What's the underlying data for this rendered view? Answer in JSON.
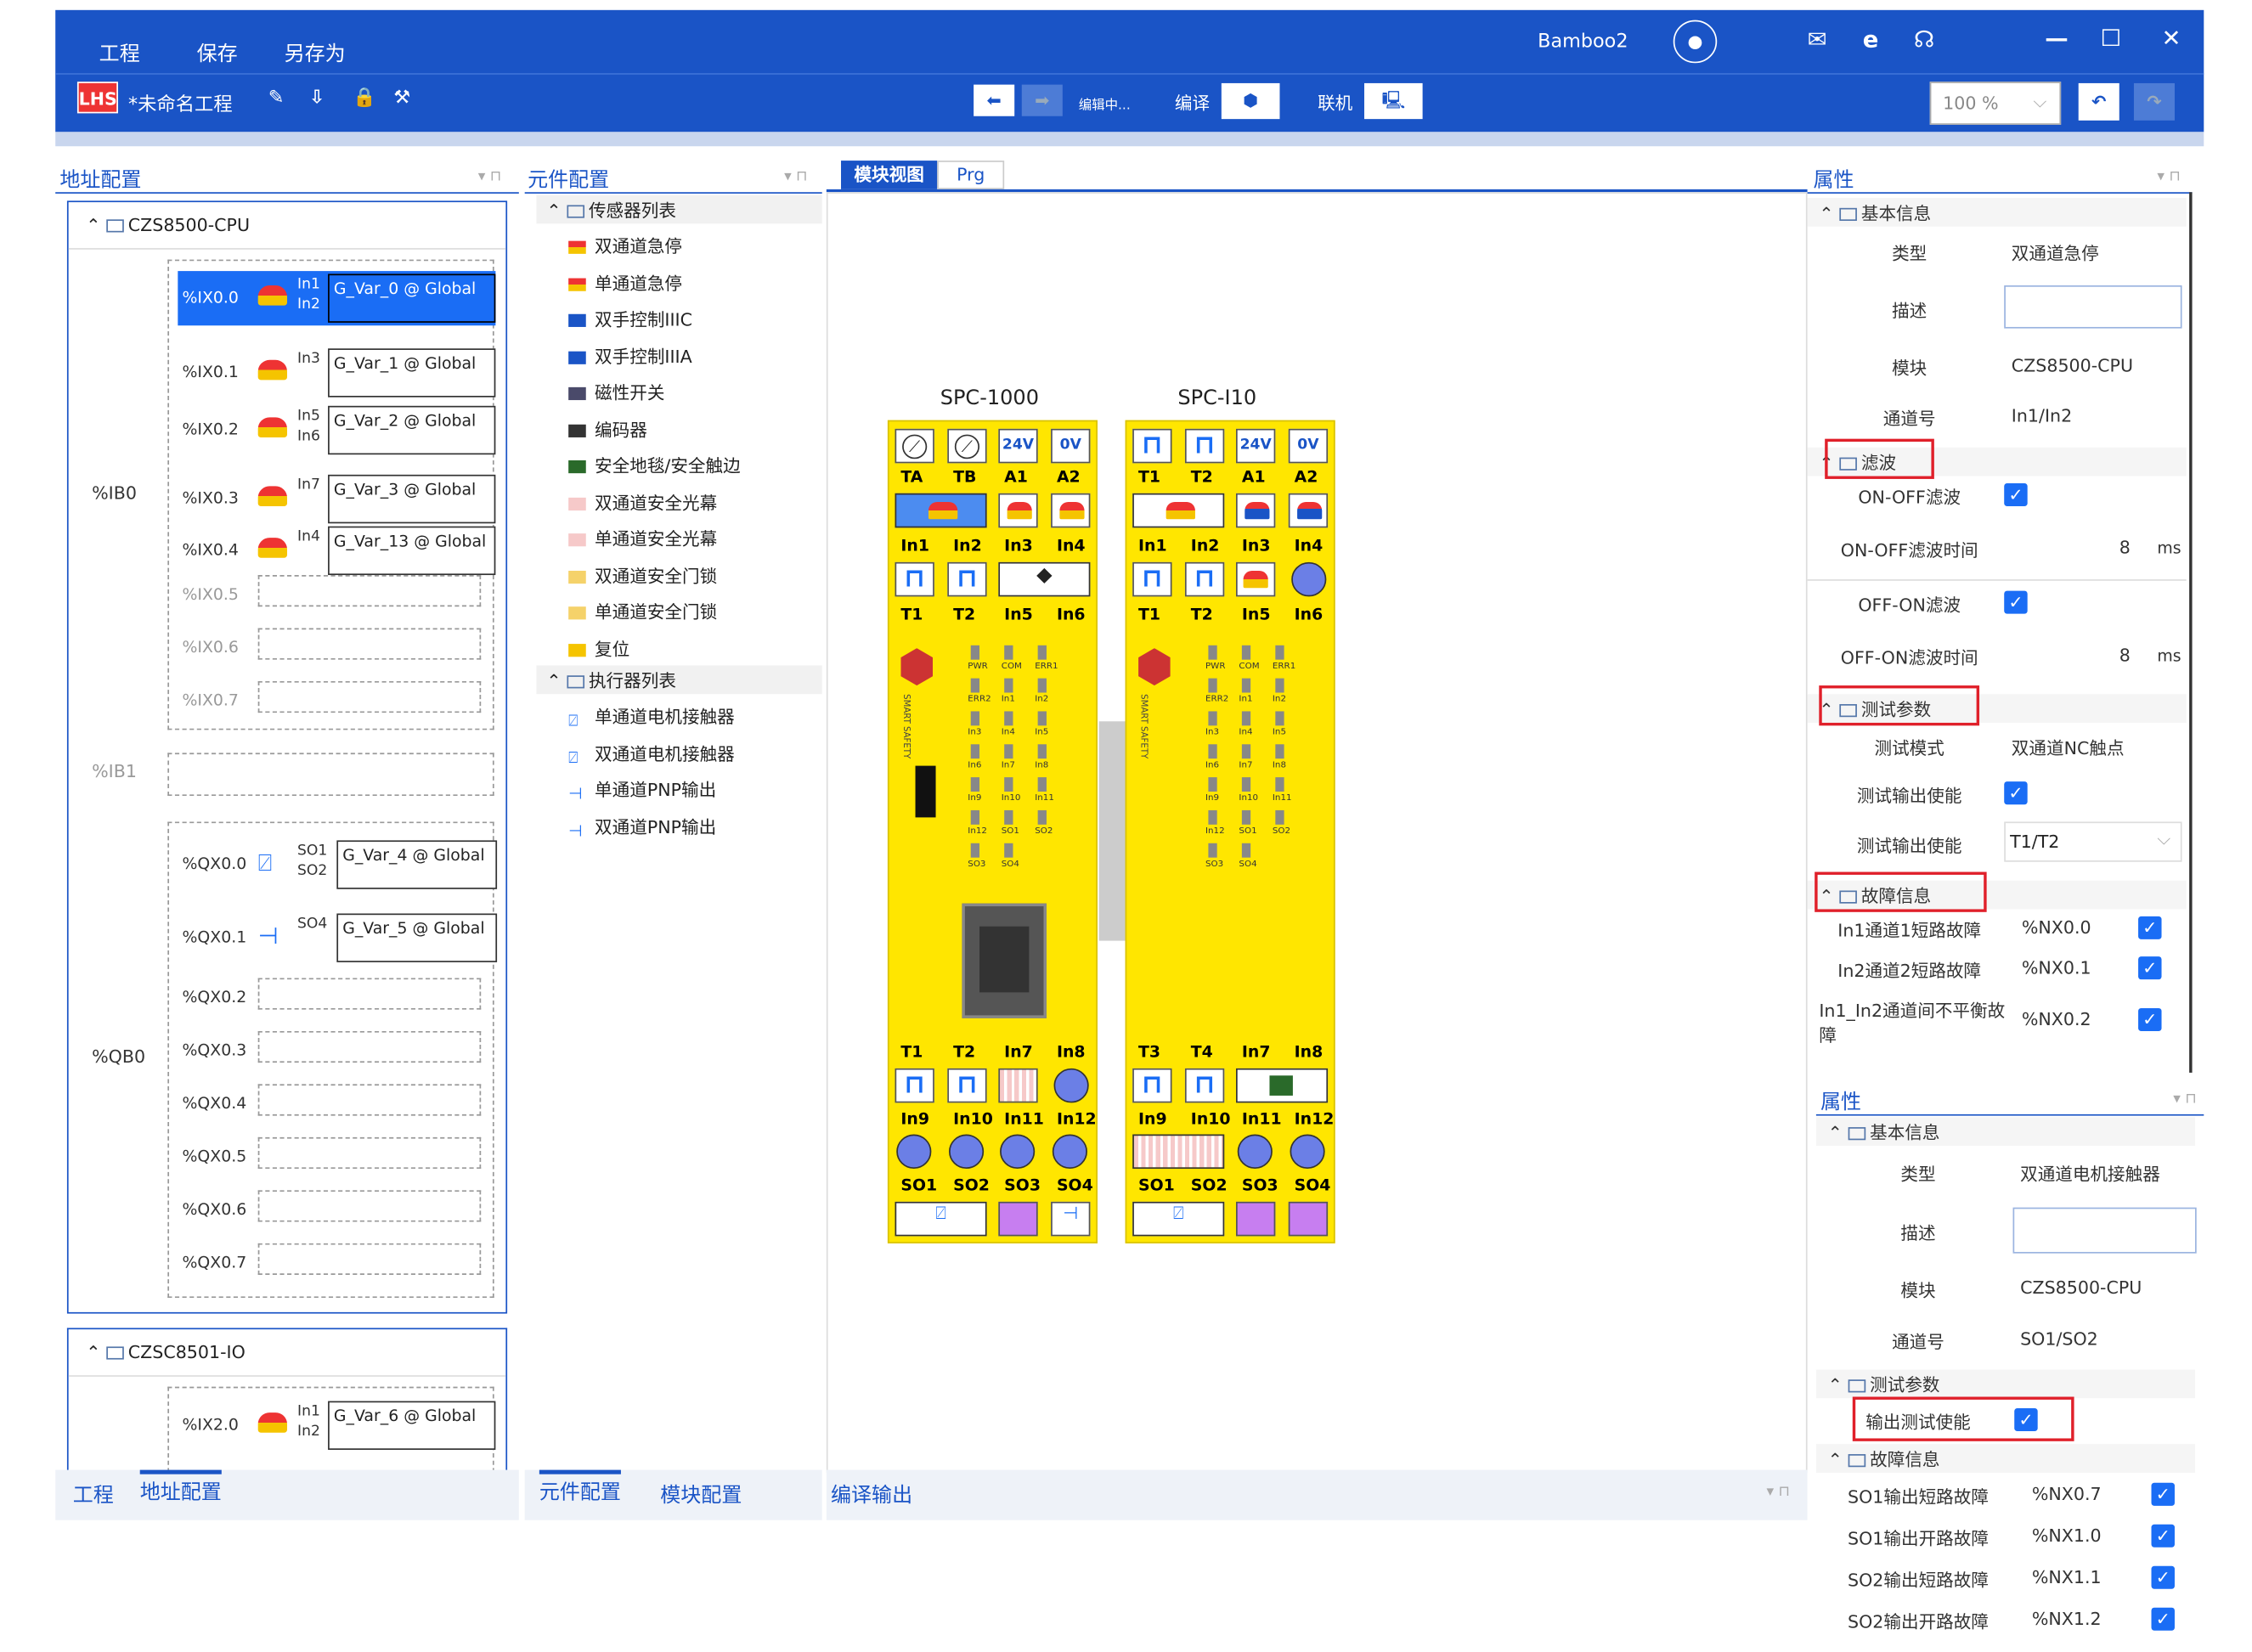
{
  "header": {
    "menu": [
      "工程",
      "保存",
      "另存为"
    ],
    "project": "*未命名工程",
    "user": "Bamboo2",
    "back_label": "编辑中...",
    "compile": "编译",
    "online": "联机",
    "zoom": "100 %"
  },
  "left": {
    "title": "地址配置",
    "bottom_tabs": [
      "工程",
      "地址配置"
    ],
    "module1": {
      "name": "CZS8500-CPU",
      "groups": [
        {
          "label": "%IB0"
        },
        {
          "label": "%IB1"
        },
        {
          "label": "%QB0"
        }
      ],
      "inputs": [
        {
          "addr": "%IX0.0",
          "pins": [
            "In1",
            "In2"
          ],
          "var": "G_Var_0 @ Global"
        },
        {
          "addr": "%IX0.1",
          "pins": [
            "In3"
          ],
          "var": "G_Var_1 @ Global"
        },
        {
          "addr": "%IX0.2",
          "pins": [
            "In5",
            "In6"
          ],
          "var": "G_Var_2 @ Global"
        },
        {
          "addr": "%IX0.3",
          "pins": [
            "In7"
          ],
          "var": "G_Var_3 @ Global"
        },
        {
          "addr": "%IX0.4",
          "pins": [
            "In4"
          ],
          "var": "G_Var_13 @ Global"
        }
      ],
      "empty_inputs": [
        "%IX0.5",
        "%IX0.6",
        "%IX0.7"
      ],
      "outputs": [
        {
          "addr": "%QX0.0",
          "pins": [
            "SO1",
            "SO2"
          ],
          "var": "G_Var_4 @ Global"
        },
        {
          "addr": "%QX0.1",
          "pins": [
            "SO4"
          ],
          "var": "G_Var_5 @ Global"
        }
      ],
      "empty_outputs": [
        "%QX0.2",
        "%QX0.3",
        "%QX0.4",
        "%QX0.5",
        "%QX0.6",
        "%QX0.7"
      ]
    },
    "module2": {
      "name": "CZSC8501-IO",
      "inputs": [
        {
          "addr": "%IX2.0",
          "pins": [
            "In1",
            "In2"
          ],
          "var": "G_Var_6 @ Global"
        }
      ]
    }
  },
  "library": {
    "title": "元件配置",
    "bottom_tabs": [
      "元件配置",
      "模块配置"
    ],
    "sensor_group": "传感器列表",
    "sensors": [
      "双通道急停",
      "单通道急停",
      "双手控制IIIC",
      "双手控制IIIA",
      "磁性开关",
      "编码器",
      "安全地毯/安全触边",
      "双通道安全光幕",
      "单通道安全光幕",
      "双通道安全门锁",
      "单通道安全门锁",
      "复位"
    ],
    "actuator_group": "执行器列表",
    "actuators": [
      "单通道电机接触器",
      "双通道电机接触器",
      "单通道PNP输出",
      "双通道PNP输出"
    ]
  },
  "center": {
    "tabs": [
      "模块视图",
      "Prg"
    ],
    "bottom_tab": "编译输出",
    "modules": [
      {
        "name": "SPC-1000",
        "top": [
          "TA",
          "TB",
          "A1",
          "A2"
        ],
        "ins1": [
          "In1",
          "In2",
          "In3",
          "In4"
        ],
        "ts1": [
          "T1",
          "T2",
          "In5",
          "In6"
        ],
        "ts2": [
          "T1",
          "T2",
          "In7",
          "In8"
        ],
        "ins2": [
          "In9",
          "In10",
          "In11",
          "In12"
        ],
        "sos": [
          "SO1",
          "SO2",
          "SO3",
          "SO4"
        ]
      },
      {
        "name": "SPC-I10",
        "top": [
          "T1",
          "T2",
          "A1",
          "A2"
        ],
        "ins1": [
          "In1",
          "In2",
          "In3",
          "In4"
        ],
        "ts1": [
          "T1",
          "T2",
          "In5",
          "In6"
        ],
        "ts2": [
          "T3",
          "T4",
          "In7",
          "In8"
        ],
        "ins2": [
          "In9",
          "In10",
          "In11",
          "In12"
        ],
        "sos": [
          "SO1",
          "SO2",
          "SO3",
          "SO4"
        ]
      }
    ],
    "v24": "24V",
    "v0": "0V",
    "leds": [
      "PWR",
      "COM",
      "ERR1",
      "ERR2",
      "In1",
      "In2",
      "In3",
      "In4",
      "In5",
      "In6",
      "In7",
      "In8",
      "In9",
      "In10",
      "In11",
      "In12",
      "SO1",
      "SO2",
      "SO3",
      "SO4"
    ],
    "brand": "SMART SAFETY"
  },
  "props1": {
    "title": "属性",
    "basic": "基本信息",
    "type_l": "类型",
    "type_v": "双通道急停",
    "desc_l": "描述",
    "module_l": "模块",
    "module_v": "CZS8500-CPU",
    "ch_l": "通道号",
    "ch_v": "In1/In2",
    "filter": "滤波",
    "onoff": "ON-OFF滤波",
    "onoff_t": "ON-OFF滤波时间",
    "onoff_t_v": "8",
    "ms": "ms",
    "offon": "OFF-ON滤波",
    "offon_t": "OFF-ON滤波时间",
    "offon_t_v": "8",
    "test": "测试参数",
    "mode_l": "测试模式",
    "mode_v": "双通道NC触点",
    "ten_l": "测试输出使能",
    "ten2_l": "测试输出使能",
    "ten2_v": "T1/T2",
    "fault": "故障信息",
    "f1": "In1通道1短路故障",
    "f1v": "%NX0.0",
    "f2": "In2通道2短路故障",
    "f2v": "%NX0.1",
    "f3": "In1_In2通道间不平衡故障",
    "f3v": "%NX0.2"
  },
  "props2": {
    "title": "属性",
    "basic": "基本信息",
    "type_l": "类型",
    "type_v": "双通道电机接触器",
    "desc_l": "描述",
    "module_l": "模块",
    "module_v": "CZS8500-CPU",
    "ch_l": "通道号",
    "ch_v": "SO1/SO2",
    "test": "测试参数",
    "oten": "输出测试使能",
    "fault": "故障信息",
    "f1": "SO1输出短路故障",
    "f1v": "%NX0.7",
    "f2": "SO1输出开路故障",
    "f2v": "%NX1.0",
    "f3": "SO2输出短路故障",
    "f3v": "%NX1.1",
    "f4": "SO2输出开路故障",
    "f4v": "%NX1.2"
  }
}
